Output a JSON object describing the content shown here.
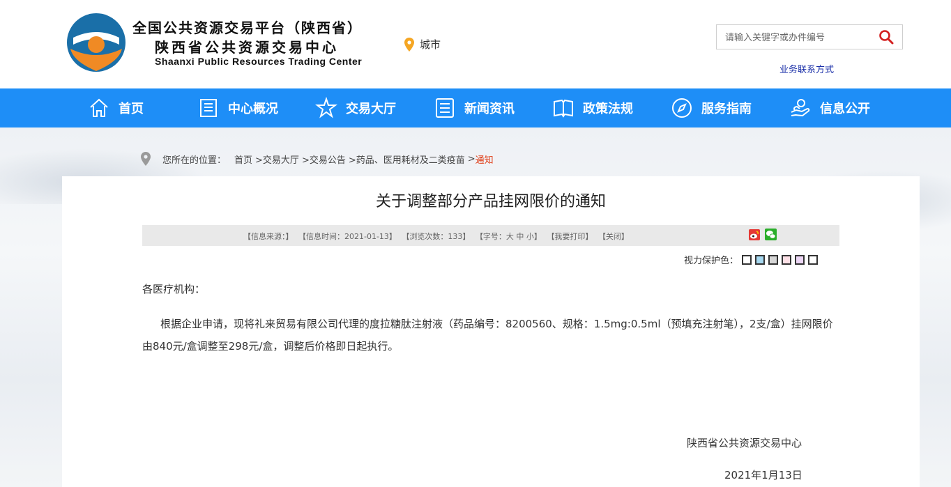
{
  "header": {
    "logo_line1": "全国公共资源交易平台（陕西省）",
    "logo_line2": "陕西省公共资源交易中心",
    "logo_line3": "Shaanxi Public Resources Trading Center",
    "city_label": "城市",
    "search_placeholder": "请输入关键字或办件编号",
    "contact_link": "业务联系方式"
  },
  "nav": {
    "items": [
      {
        "label": "首页",
        "icon": "home-icon"
      },
      {
        "label": "中心概况",
        "icon": "document-icon"
      },
      {
        "label": "交易大厅",
        "icon": "star-icon"
      },
      {
        "label": "新闻资讯",
        "icon": "news-icon"
      },
      {
        "label": "政策法规",
        "icon": "book-icon"
      },
      {
        "label": "服务指南",
        "icon": "compass-icon"
      },
      {
        "label": "信息公开",
        "icon": "hand-icon"
      }
    ]
  },
  "breadcrumb": {
    "prefix": "您所在的位置：",
    "items": [
      "首页",
      ">交易大厅",
      ">交易公告",
      ">药品、医用耗材及二类疫苗",
      ">"
    ],
    "current": "通知"
  },
  "article": {
    "title": "关于调整部分产品挂网限价的通知",
    "info": {
      "source": "【信息来源：】",
      "time": "【信息时间：2021-01-13】",
      "views": "【浏览次数：133】",
      "font_size": "【字号：大 中 小】",
      "print": "【我要打印】",
      "close": "【关闭】"
    },
    "eye_protection_label": "视力保护色：",
    "eye_colors": [
      "#ffffff",
      "#a6d8f0",
      "#d6d6d6",
      "#fde0e6",
      "#ecd6f5",
      "#ffffff"
    ],
    "greeting": "各医疗机构：",
    "body": "根据企业申请，现将礼来贸易有限公司代理的度拉糖肽注射液（药品编号：8200560、规格：1.5mg:0.5ml（预填充注射笔），2支/盒）挂网限价由840元/盒调整至298元/盒，调整后价格即日起执行。",
    "sign_org": "陕西省公共资源交易中心",
    "sign_date": "2021年1月13日"
  },
  "colors": {
    "nav_bg": "#1e8ef7",
    "logo_blue": "#1a6fa8",
    "logo_orange": "#f08a24",
    "breadcrumb_current": "#e0401a",
    "search_icon": "#d32020"
  }
}
